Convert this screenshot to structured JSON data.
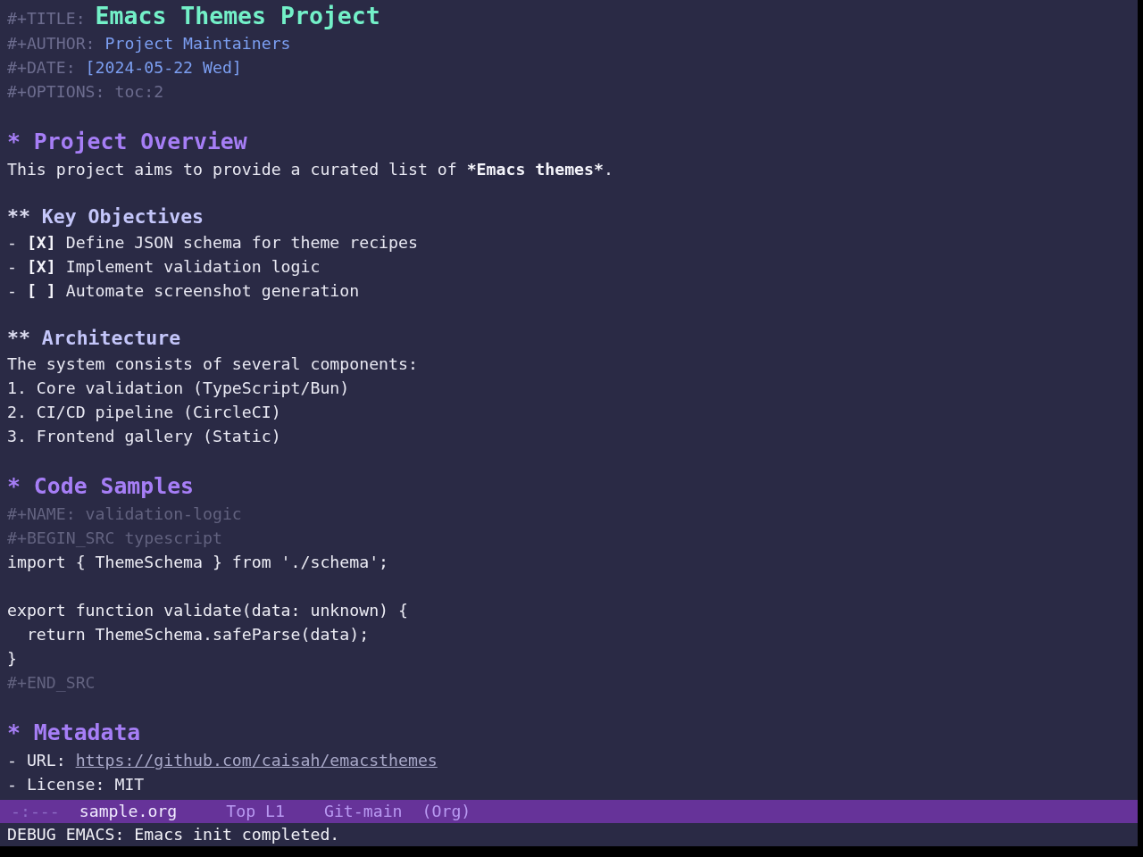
{
  "buffer": {
    "header": [
      {
        "kind": "title",
        "key": "#+TITLE:",
        "value": "Emacs Themes Project"
      },
      {
        "kind": "author",
        "key": "#+AUTHOR:",
        "value": "Project Maintainers"
      },
      {
        "kind": "date",
        "key": "#+DATE:",
        "value": "[2024-05-22 Wed]"
      },
      {
        "kind": "option",
        "key": "#+OPTIONS:",
        "value": "toc:2"
      }
    ],
    "sections": [
      {
        "marker": "*",
        "title": "Project Overview",
        "body": [
          {
            "kind": "paragraph",
            "parts": [
              {
                "text": "This project aims to provide a curated list of ",
                "bold": false
              },
              {
                "text": "*Emacs themes*",
                "bold": true
              },
              {
                "text": ".",
                "bold": false
              }
            ]
          }
        ],
        "children": [
          {
            "marker": "**",
            "title": "Key Objectives",
            "body": [
              {
                "kind": "checkbox",
                "bullet": "-",
                "box": "[X]",
                "label": "Define JSON schema for theme recipes"
              },
              {
                "kind": "checkbox",
                "bullet": "-",
                "box": "[X]",
                "label": "Implement validation logic"
              },
              {
                "kind": "checkbox",
                "bullet": "-",
                "box": "[ ]",
                "label": "Automate screenshot generation"
              }
            ]
          },
          {
            "marker": "**",
            "title": "Architecture",
            "body": [
              {
                "kind": "paragraph",
                "parts": [
                  {
                    "text": "The system consists of several components:",
                    "bold": false
                  }
                ]
              },
              {
                "kind": "numbered",
                "text": "1. Core validation (TypeScript/Bun)"
              },
              {
                "kind": "numbered",
                "text": "2. CI/CD pipeline (CircleCI)"
              },
              {
                "kind": "numbered",
                "text": "3. Frontend gallery (Static)"
              }
            ]
          }
        ]
      },
      {
        "marker": "*",
        "title": "Code Samples",
        "body": [
          {
            "kind": "directive",
            "text": "#+NAME: validation-logic"
          },
          {
            "kind": "directive",
            "text": "#+BEGIN_SRC typescript"
          },
          {
            "kind": "code",
            "text": "import { ThemeSchema } from './schema';\n\nexport function validate(data: unknown) {\n  return ThemeSchema.safeParse(data);\n}"
          },
          {
            "kind": "directive",
            "text": "#+END_SRC"
          }
        ]
      },
      {
        "marker": "*",
        "title": "Metadata",
        "body": [
          {
            "kind": "link_field",
            "label": "- URL:",
            "url": "https://github.com/caisah/emacsthemes"
          },
          {
            "kind": "field",
            "text": "- License: MIT"
          }
        ]
      }
    ]
  },
  "mode_line": {
    "state": "-:---",
    "buffer_name": "sample.org",
    "position": "Top L1",
    "vc": "Git-main",
    "mode": "(Org)"
  },
  "echo_area": {
    "message": "DEBUG EMACS: Emacs init completed."
  }
}
